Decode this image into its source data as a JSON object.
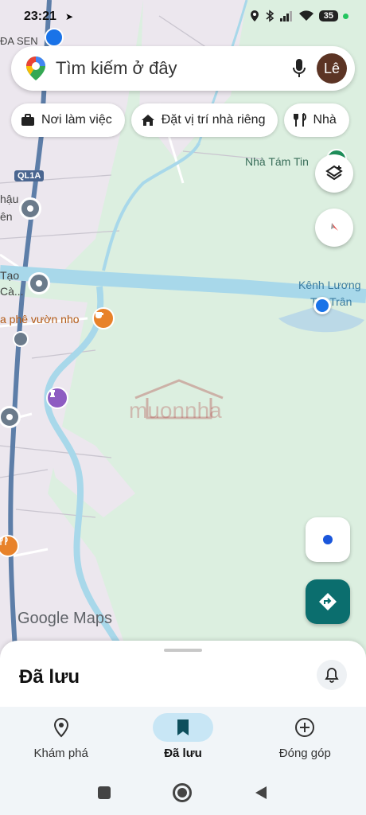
{
  "status_bar": {
    "time": "23:21",
    "battery": "35"
  },
  "search": {
    "placeholder": "Tìm kiếm ở đây",
    "avatar_initials": "Lê"
  },
  "chips": [
    {
      "label": "Nơi làm việc",
      "icon": "briefcase-icon"
    },
    {
      "label": "Đặt vị trí nhà riêng",
      "icon": "home-icon"
    },
    {
      "label": "Nhà",
      "icon": "fork-knife-icon"
    }
  ],
  "map": {
    "labels": {
      "sen": "ĐA SEN",
      "road": "QL1A",
      "nha_tam_tin": "Nhà Tám Tin",
      "hau_1": "hậu",
      "hau_2": "ên",
      "tao_1": "Tạo",
      "tao_2": "Cà...",
      "cafe": "a phê vườn nho",
      "canal_1": "Kênh Lương",
      "canal_2": "Trà Trân",
      "watermark": "muonnha"
    },
    "colors": {
      "land": "#dcefe0",
      "water": "#a8d8ea",
      "urban": "#ede8ee",
      "accent": "#1a73e8"
    }
  },
  "map_controls": {
    "layers": "layers-icon",
    "compass": "compass-icon",
    "locate": "my-location-icon",
    "directions": "directions-icon"
  },
  "brand": {
    "google_maps": "Google Maps"
  },
  "sheet": {
    "title": "Đã lưu"
  },
  "bottom_nav": [
    {
      "label": "Khám phá",
      "icon": "location-pin-icon",
      "active": false
    },
    {
      "label": "Đã lưu",
      "icon": "bookmark-icon",
      "active": true
    },
    {
      "label": "Đóng góp",
      "icon": "add-circle-icon",
      "active": false
    }
  ]
}
